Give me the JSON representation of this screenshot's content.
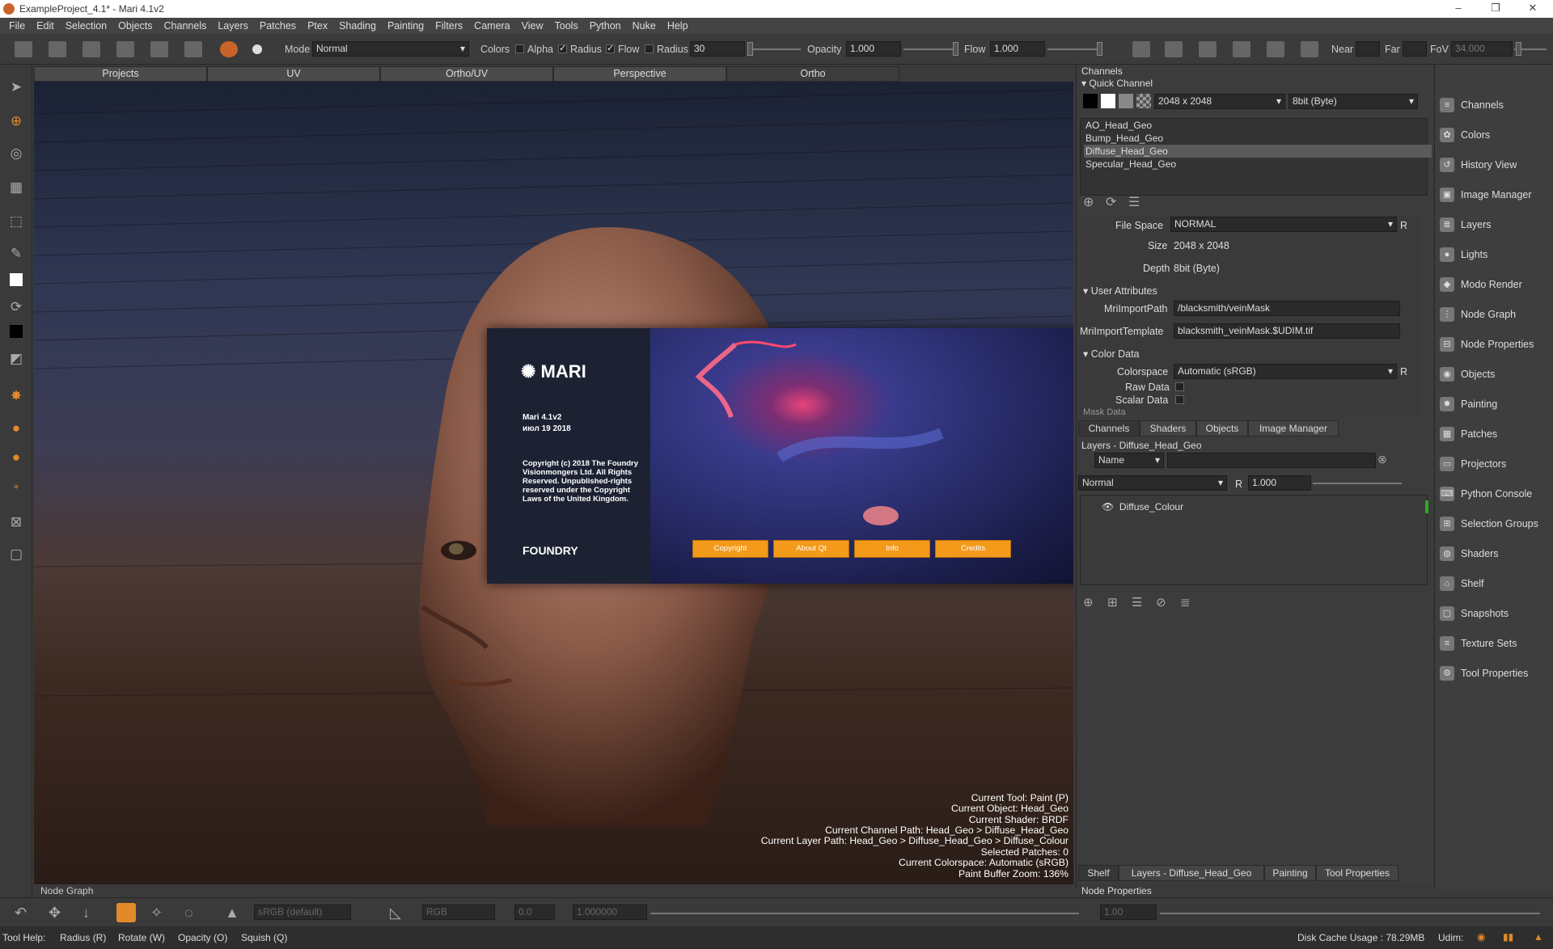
{
  "window": {
    "title": "ExampleProject_4.1* - Mari 4.1v2",
    "min_icon": "minimize-icon",
    "max_icon": "restore-icon",
    "close_icon": "close-icon"
  },
  "menu": [
    "File",
    "Edit",
    "Selection",
    "Objects",
    "Channels",
    "Layers",
    "Patches",
    "Ptex",
    "Shading",
    "Painting",
    "Filters",
    "Camera",
    "View",
    "Tools",
    "Python",
    "Nuke",
    "Help"
  ],
  "toolbar": {
    "mode_label": "Mode",
    "mode_value": "Normal",
    "colors_label": "Colors",
    "alpha_label": "Alpha",
    "alpha_checked": false,
    "radius_chk_label": "Radius",
    "radius_chk_checked": true,
    "flow_chk_label": "Flow",
    "flow_chk_checked": true,
    "radius_label": "Radius",
    "radius_value": "30",
    "opacity_label": "Opacity",
    "opacity_value": "1.000",
    "flow_label": "Flow",
    "flow_value": "1.000",
    "near_label": "Near",
    "far_label": "Far",
    "fov_label": "FoV",
    "fov_value": "34.000"
  },
  "view_tabs": [
    "Projects",
    "UV",
    "Ortho/UV",
    "Perspective",
    "Ortho"
  ],
  "active_view_tab": "Ortho",
  "splash": {
    "product": "MARI",
    "version": "Mari 4.1v2",
    "date": "июл 19 2018",
    "copyright": "Copyright (c) 2018 The Foundry Visionmongers Ltd. All Rights Reserved. Unpublished-rights reserved under the Copyright Laws of the United Kingdom.",
    "company": "FOUNDRY",
    "buttons": [
      "Copyright",
      "About Qt",
      "Info",
      "Credits"
    ],
    "button_color": "#f39a1b"
  },
  "viewport_info": [
    "Current Tool: Paint (P)",
    "Current Object: Head_Geo",
    "Current Shader: BRDF",
    "Current Channel Path: Head_Geo > Diffuse_Head_Geo",
    "Current Layer Path: Head_Geo > Diffuse_Head_Geo > Diffuse_Colour",
    "Selected Patches: 0",
    "Current Colorspace: Automatic (sRGB)",
    "Paint Buffer Zoom: 136%"
  ],
  "node_graph_label": "Node Graph",
  "channels_panel": {
    "title": "Channels",
    "quick_channel_label": "Quick Channel",
    "size_value": "2048 x 2048",
    "depth_value": "8bit (Byte)",
    "channels": [
      {
        "name": "AO_Head_Geo",
        "selected": false
      },
      {
        "name": "Bump_Head_Geo",
        "selected": false
      },
      {
        "name": "Diffuse_Head_Geo",
        "selected": true
      },
      {
        "name": "Specular_Head_Geo",
        "selected": false
      }
    ],
    "file_space_label": "File Space",
    "file_space_value": "NORMAL",
    "size_label": "Size",
    "size_prop": "2048 x 2048",
    "depth_label": "Depth",
    "depth_prop": "8bit  (Byte)",
    "user_attributes_label": "User Attributes",
    "import_path_label": "MriImportPath",
    "import_path_value": "/blacksmith/veinMask",
    "import_template_label": "MriImportTemplate",
    "import_template_value": "blacksmith_veinMask.$UDIM.tif",
    "color_data_label": "Color Data",
    "colorspace_label": "Colorspace",
    "colorspace_value": "Automatic (sRGB)",
    "raw_data_label": "Raw Data",
    "scalar_data_label": "Scalar Data",
    "mask_data_label": "Mask Data",
    "r_label": "R"
  },
  "channels_tabs": [
    "Channels",
    "Shaders",
    "Objects",
    "Image Manager"
  ],
  "layers_panel": {
    "title": "Layers - Diffuse_Head_Geo",
    "filter_value": "Name",
    "blend_value": "Normal",
    "r_label": "R",
    "opacity_value": "1.000",
    "layers": [
      {
        "name": "Diffuse_Colour"
      }
    ]
  },
  "bottom_tabs": [
    "Shelf",
    "Layers - Diffuse_Head_Geo",
    "Painting",
    "Tool Properties"
  ],
  "node_properties_label": "Node Properties",
  "sidebar": [
    {
      "label": "Channels",
      "icon": "channels-icon"
    },
    {
      "label": "Colors",
      "icon": "colors-icon"
    },
    {
      "label": "History View",
      "icon": "history-icon"
    },
    {
      "label": "Image Manager",
      "icon": "image-manager-icon"
    },
    {
      "label": "Layers",
      "icon": "layers-icon"
    },
    {
      "label": "Lights",
      "icon": "lights-icon"
    },
    {
      "label": "Modo Render",
      "icon": "modo-render-icon"
    },
    {
      "label": "Node Graph",
      "icon": "node-graph-icon"
    },
    {
      "label": "Node Properties",
      "icon": "node-properties-icon"
    },
    {
      "label": "Objects",
      "icon": "objects-icon"
    },
    {
      "label": "Painting",
      "icon": "painting-icon"
    },
    {
      "label": "Patches",
      "icon": "patches-icon"
    },
    {
      "label": "Projectors",
      "icon": "projectors-icon"
    },
    {
      "label": "Python Console",
      "icon": "python-console-icon"
    },
    {
      "label": "Selection Groups",
      "icon": "selection-groups-icon"
    },
    {
      "label": "Shaders",
      "icon": "shaders-icon"
    },
    {
      "label": "Shelf",
      "icon": "shelf-icon"
    },
    {
      "label": "Snapshots",
      "icon": "snapshots-icon"
    },
    {
      "label": "Texture Sets",
      "icon": "texture-sets-icon"
    },
    {
      "label": "Tool Properties",
      "icon": "tool-properties-icon"
    }
  ],
  "bottom_bar": {
    "colorspace_value": "sRGB (default)",
    "channel_value": "RGB",
    "exposure_value": "0.0",
    "gain_value": "1.000000",
    "gamma_value": "1.00"
  },
  "status": {
    "tool_help_label": "Tool Help:",
    "hints": [
      "Radius (R)",
      "Rotate (W)",
      "Opacity (O)",
      "Squish (Q)"
    ],
    "disk_cache": "Disk Cache Usage : 78.29MB",
    "udim_label": "Udim:"
  }
}
